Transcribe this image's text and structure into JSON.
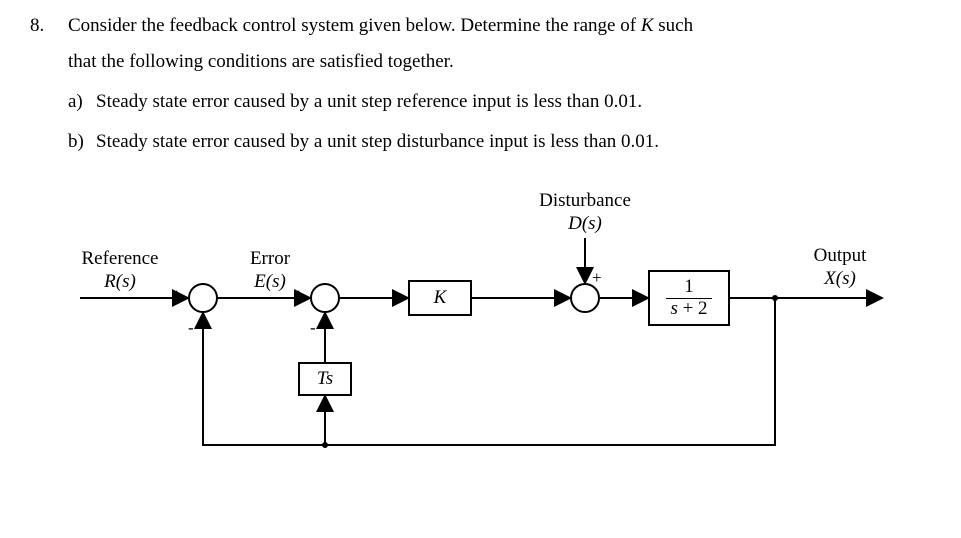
{
  "question": {
    "number": "8.",
    "line1": "Consider the feedback control system given below. Determine the range of ",
    "Kvar": "K",
    "line1_tail": " such",
    "line2": "that the following conditions are satisfied together.",
    "sub_a_label": "a)",
    "sub_a_text": "Steady state error caused by a unit step reference input is less than 0.01.",
    "sub_b_label": "b)",
    "sub_b_text": "Steady state error caused by a unit step disturbance input is less than 0.01."
  },
  "diagram": {
    "reference_label": "Reference",
    "reference_sym": "R(s)",
    "error_label": "Error",
    "error_sym": "E(s)",
    "disturbance_label": "Disturbance",
    "disturbance_sym": "D(s)",
    "output_label": "Output",
    "output_sym": "X(s)",
    "block_K": "K",
    "block_Ts": "Ts",
    "plant_num": "1",
    "plant_den": "s + 2",
    "plus1": "+",
    "minus1": "-",
    "plus2": "+",
    "minus2": "-",
    "plus3a": "+",
    "plus3b": "+"
  },
  "chart_data": {
    "type": "diagram",
    "description": "Feedback control block diagram",
    "blocks": [
      {
        "id": "sum1",
        "type": "summer",
        "inputs": [
          "R(s) +",
          "feedback -"
        ],
        "output": "E(s)"
      },
      {
        "id": "sum2",
        "type": "summer",
        "inputs": [
          "E(s) +",
          "Ts*X(s) -"
        ]
      },
      {
        "id": "K",
        "type": "gain",
        "tf": "K"
      },
      {
        "id": "sum3",
        "type": "summer",
        "inputs": [
          "K_out +",
          "D(s) +"
        ]
      },
      {
        "id": "plant",
        "type": "tf",
        "tf": "1/(s+2)",
        "output": "X(s)"
      },
      {
        "id": "Ts",
        "type": "tf",
        "tf": "Ts"
      }
    ],
    "connections": [
      [
        "R(s)",
        "sum1"
      ],
      [
        "sum1",
        "sum2"
      ],
      [
        "sum2",
        "K"
      ],
      [
        "K",
        "sum3"
      ],
      [
        "D(s)",
        "sum3"
      ],
      [
        "sum3",
        "plant"
      ],
      [
        "plant",
        "X(s)"
      ],
      [
        "X(s)",
        "Ts"
      ],
      [
        "Ts",
        "sum2"
      ],
      [
        "X(s)",
        "sum1"
      ]
    ]
  }
}
